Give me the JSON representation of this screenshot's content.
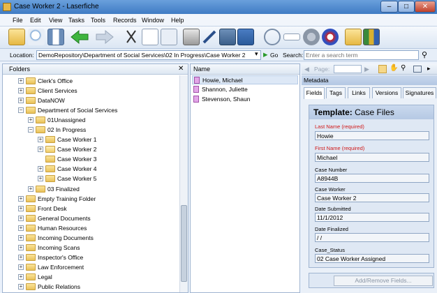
{
  "window": {
    "title": "Case Worker 2 - Laserfiche",
    "min": "–",
    "max": "□",
    "close": "✕"
  },
  "menu": [
    "File",
    "Edit",
    "View",
    "Tasks",
    "Tools",
    "Records",
    "Window",
    "Help"
  ],
  "location": {
    "label": "Location:",
    "path": "DemoRepository\\Department of Social Services\\02 In Progress\\Case Worker 2",
    "go": "Go",
    "search_label": "Search:",
    "search_placeholder": "Enter a search term"
  },
  "folders": {
    "title": "Folders",
    "close": "✕",
    "tree": [
      {
        "label": "Clerk's Office",
        "exp": "+"
      },
      {
        "label": "Client Services",
        "exp": "+"
      },
      {
        "label": "DataNOW",
        "exp": "+"
      },
      {
        "label": "Department of Social Services",
        "exp": "−"
      },
      {
        "label": "01Unassigned",
        "exp": "+"
      },
      {
        "label": "02 In Progress",
        "exp": "−"
      },
      {
        "label": "Case Worker 1",
        "exp": "+"
      },
      {
        "label": "Case Worker 2",
        "exp": "+"
      },
      {
        "label": "Case Worker 3",
        "exp": ""
      },
      {
        "label": "Case Worker 4",
        "exp": "+"
      },
      {
        "label": "Case Worker 5",
        "exp": "+"
      },
      {
        "label": "03 Finalized",
        "exp": "+"
      },
      {
        "label": "Empty Training Folder",
        "exp": "+"
      },
      {
        "label": "Front Desk",
        "exp": "+"
      },
      {
        "label": "General Documents",
        "exp": "+"
      },
      {
        "label": "Human Resources",
        "exp": "+"
      },
      {
        "label": "Incoming Documents",
        "exp": "+"
      },
      {
        "label": "Incoming Scans",
        "exp": "+"
      },
      {
        "label": "Inspector's Office",
        "exp": "+"
      },
      {
        "label": "Law Enforcement",
        "exp": "+"
      },
      {
        "label": "Legal",
        "exp": "+"
      },
      {
        "label": "Public Relations",
        "exp": "+"
      }
    ]
  },
  "list": {
    "column": "Name",
    "items": [
      "Howie, Michael",
      "Shannon, Juliette",
      "Stevenson, Shaun"
    ]
  },
  "viewer": {
    "page_label": "Page:"
  },
  "metadata": {
    "header": "Metadata",
    "tabs": [
      "Fields",
      "Tags",
      "Links",
      "Versions",
      "Signatures"
    ],
    "template_label": "Template:",
    "template_name": "Case Files",
    "fields": [
      {
        "label": "Last Name (required)",
        "value": "Howie",
        "required": true
      },
      {
        "label": "First Name (required)",
        "value": "Michael",
        "required": true
      },
      {
        "label": "Case Number",
        "value": "A8944B",
        "required": false
      },
      {
        "label": "Case Worker",
        "value": "Case Worker 2",
        "required": false
      },
      {
        "label": "Date Submitted",
        "value": "11/1/2012",
        "required": false
      },
      {
        "label": "Date Finalized",
        "value": " / /",
        "required": false
      },
      {
        "label": "Case_Status",
        "value": "02 Case Worker Assigned",
        "required": false
      }
    ],
    "add_remove": "Add/Remove Fields..."
  }
}
